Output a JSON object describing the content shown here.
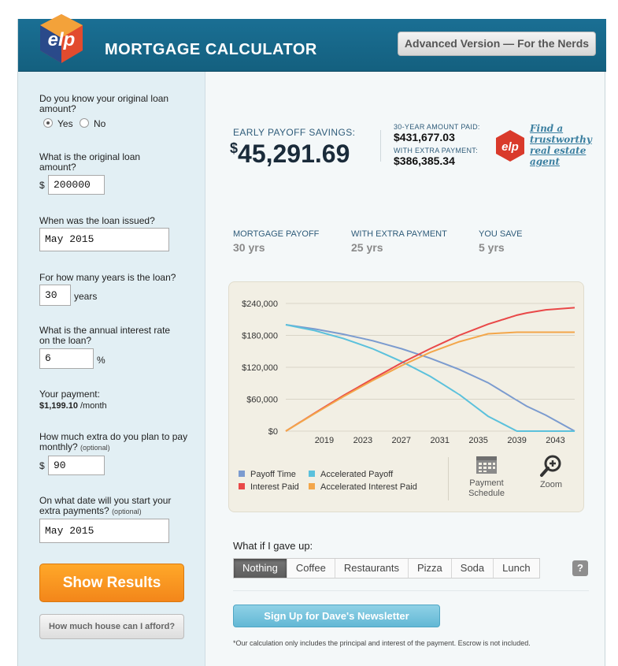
{
  "header": {
    "title": "MORTGAGE CALCULATOR",
    "advanced_button": "Advanced Version — For the Nerds"
  },
  "sidebar": {
    "q_known": "Do you know your original loan amount?",
    "yes_label": "Yes",
    "no_label": "No",
    "known_selected": "Yes",
    "q_amount": "What is the original loan amount?",
    "currency": "$",
    "amount_value": "200000",
    "q_issued": "When was the loan issued?",
    "issued_value": "May 2015",
    "q_years": "For how many years is the loan?",
    "years_value": "30",
    "years_unit": "years",
    "q_rate": "What is the annual interest rate on the loan?",
    "rate_value": "6",
    "rate_unit": "%",
    "payment_label": "Your payment:",
    "payment_value": "$1,199.10",
    "payment_unit": "/month",
    "q_extra": "How much extra do you plan to pay monthly?",
    "optional": "(optional)",
    "extra_value": "90",
    "q_start": "On what date will you start your extra payments?",
    "start_value": "May 2015",
    "show_button": "Show Results",
    "afford_button": "How much house can I afford?"
  },
  "results": {
    "savings_label": "EARLY PAYOFF SAVINGS:",
    "savings_currency": "$",
    "savings_value": "45,291.69",
    "thirty_label": "30-YEAR AMOUNT PAID:",
    "thirty_value": "$431,677.03",
    "extra_label": "WITH EXTRA PAYMENT:",
    "extra_value": "$386,385.34",
    "agent_link": "Find a trustworthy real estate agent",
    "payoff_label": "MORTGAGE PAYOFF",
    "payoff_value": "30 yrs",
    "with_extra_label": "WITH EXTRA PAYMENT",
    "with_extra_value": "25 yrs",
    "save_label": "YOU SAVE",
    "save_value": "5 yrs"
  },
  "legend": {
    "payoff_time": "Payoff Time",
    "accel_payoff": "Accelerated Payoff",
    "interest_paid": "Interest Paid",
    "accel_interest": "Accelerated Interest Paid",
    "schedule": "Payment Schedule",
    "zoom": "Zoom"
  },
  "colors": {
    "payoff_time": "#7b9bcf",
    "accel_payoff": "#5bc1dc",
    "interest_paid": "#e94848",
    "accel_interest": "#f3a64a"
  },
  "chart_data": {
    "type": "line",
    "ylim": [
      0,
      240000
    ],
    "yticks": [
      0,
      60000,
      120000,
      180000,
      240000
    ],
    "ytick_labels": [
      "$0",
      "$60,000",
      "$120,000",
      "$180,000",
      "$240,000"
    ],
    "xlim": [
      2015,
      2045
    ],
    "xticks": [
      2019,
      2023,
      2027,
      2031,
      2035,
      2039,
      2043
    ],
    "x": [
      2015,
      2018,
      2021,
      2024,
      2027,
      2030,
      2033,
      2036,
      2039,
      2040,
      2042,
      2045
    ],
    "series": [
      {
        "name": "Payoff Time",
        "values": [
          200000,
          192000,
          182000,
          170000,
          155000,
          137000,
          116000,
          91000,
          58000,
          47000,
          30000,
          0
        ]
      },
      {
        "name": "Accelerated Payoff",
        "values": [
          200000,
          189000,
          174000,
          155000,
          131000,
          103000,
          69000,
          28000,
          0,
          0,
          0,
          0
        ]
      },
      {
        "name": "Interest Paid",
        "values": [
          0,
          34000,
          67000,
          98000,
          128000,
          155000,
          180000,
          201000,
          218000,
          222000,
          228000,
          232000
        ]
      },
      {
        "name": "Accelerated Interest Paid",
        "values": [
          0,
          33000,
          65000,
          95000,
          123000,
          148000,
          168000,
          183000,
          186000,
          186000,
          186000,
          186000
        ]
      }
    ]
  },
  "gaveup": {
    "label": "What if I gave up:",
    "options": [
      "Nothing",
      "Coffee",
      "Restaurants",
      "Pizza",
      "Soda",
      "Lunch"
    ],
    "selected": "Nothing",
    "help": "?"
  },
  "newsletter_button": "Sign Up for Dave's Newsletter",
  "footnote": "*Our calculation only includes the principal and interest of the payment. Escrow is not included."
}
